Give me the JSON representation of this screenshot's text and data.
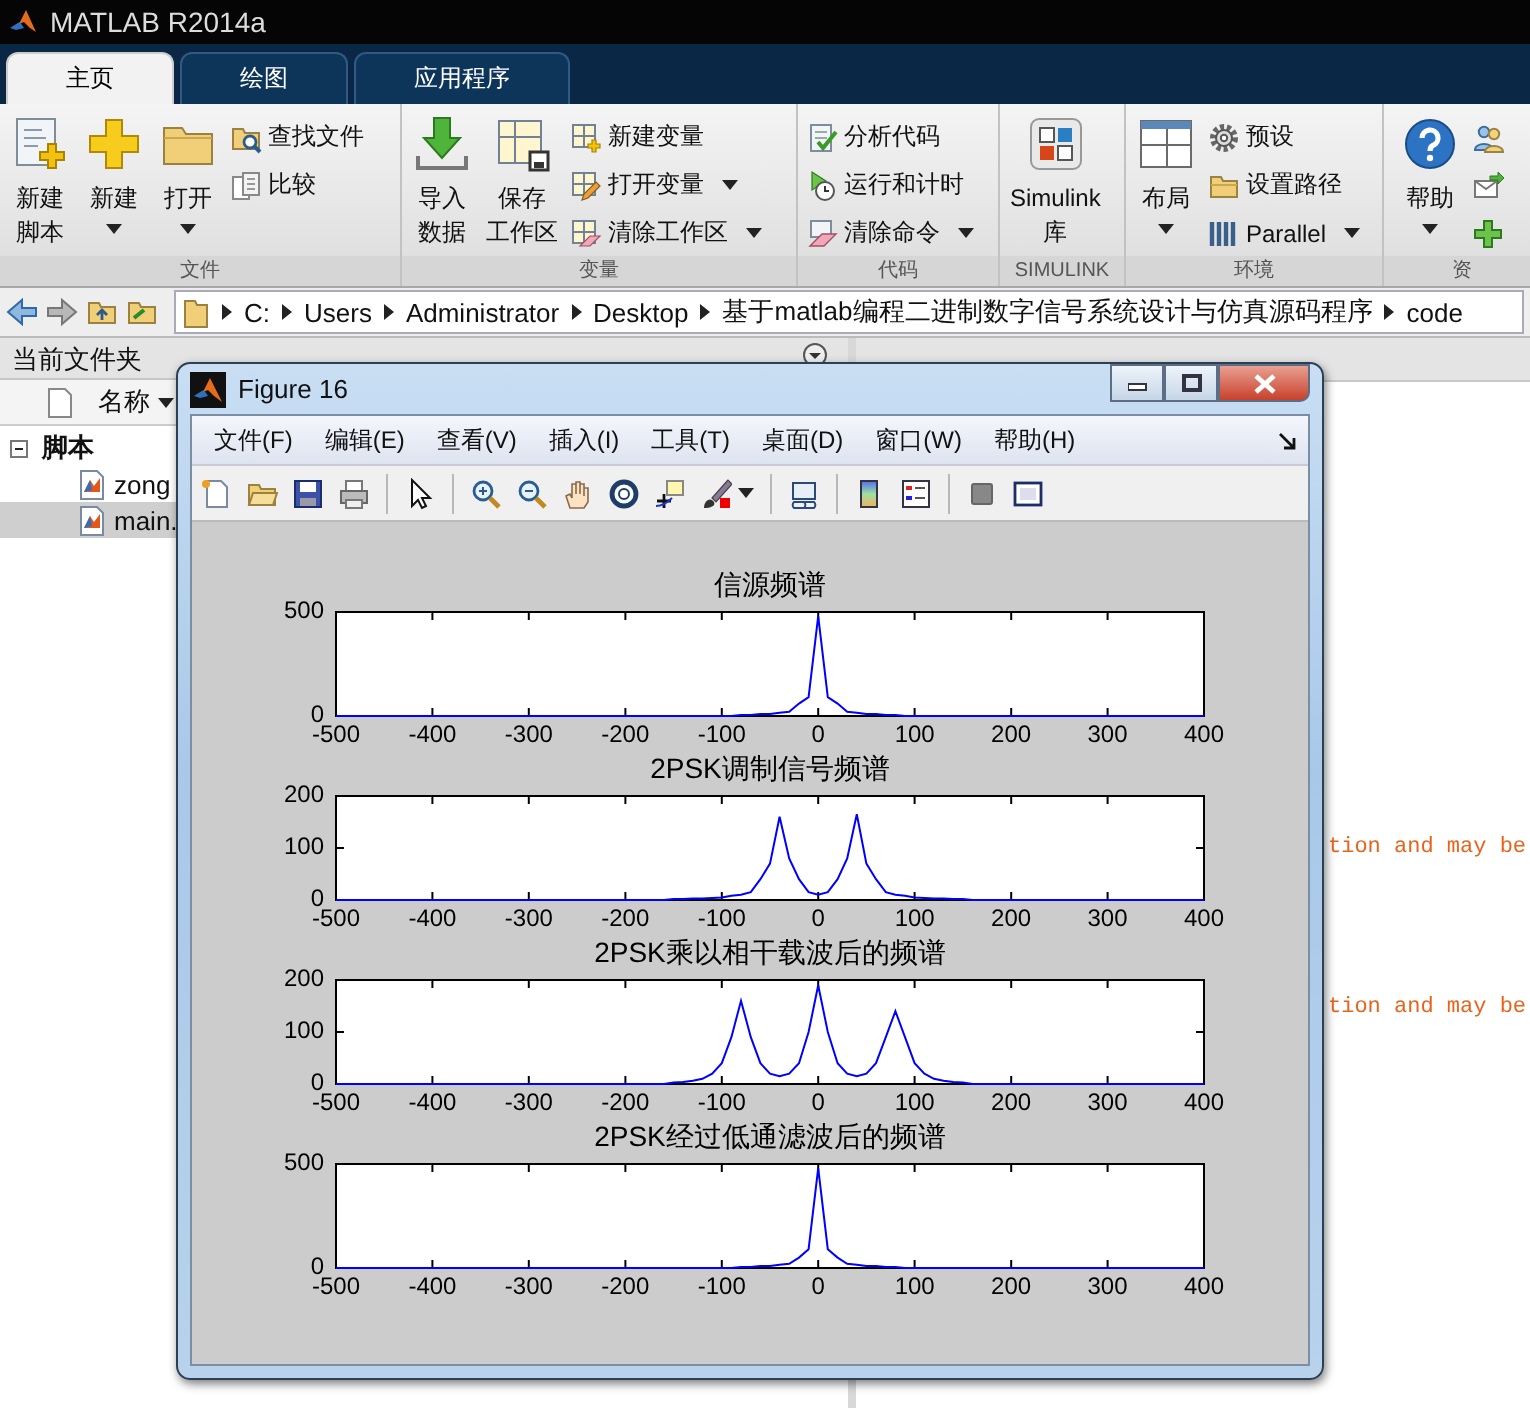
{
  "app": {
    "title": "MATLAB R2014a"
  },
  "tabs": [
    {
      "label": "主页",
      "selected": true
    },
    {
      "label": "绘图",
      "selected": false
    },
    {
      "label": "应用程序",
      "selected": false
    }
  ],
  "toolstrip": {
    "sections": [
      {
        "label": "文件",
        "items": [
          {
            "kind": "large",
            "lines": [
              "新建",
              "脚本"
            ],
            "dropdown": false
          },
          {
            "kind": "large",
            "lines": [
              "新建"
            ],
            "dropdown": true
          },
          {
            "kind": "large",
            "lines": [
              "打开"
            ],
            "dropdown": true
          },
          {
            "kind": "stack",
            "items": [
              {
                "label": "查找文件",
                "dropdown": false
              },
              {
                "label": "比较",
                "dropdown": false
              }
            ]
          }
        ]
      },
      {
        "label": "变量",
        "items": [
          {
            "kind": "large",
            "lines": [
              "导入",
              "数据"
            ],
            "dropdown": false
          },
          {
            "kind": "large",
            "lines": [
              "保存",
              "工作区"
            ],
            "dropdown": false
          },
          {
            "kind": "stack",
            "items": [
              {
                "label": "新建变量",
                "dropdown": false
              },
              {
                "label": "打开变量",
                "dropdown": true
              },
              {
                "label": "清除工作区",
                "dropdown": true
              }
            ]
          }
        ]
      },
      {
        "label": "代码",
        "items": [
          {
            "kind": "stack",
            "items": [
              {
                "label": "分析代码",
                "dropdown": false
              },
              {
                "label": "运行和计时",
                "dropdown": false
              },
              {
                "label": "清除命令",
                "dropdown": true
              }
            ]
          }
        ]
      },
      {
        "label": "SIMULINK",
        "items": [
          {
            "kind": "large",
            "lines": [
              "Simulink",
              "库"
            ],
            "dropdown": false
          }
        ]
      },
      {
        "label": "环境",
        "items": [
          {
            "kind": "large",
            "lines": [
              "布局"
            ],
            "dropdown": true
          },
          {
            "kind": "stack",
            "items": [
              {
                "label": "预设",
                "dropdown": false
              },
              {
                "label": "设置路径",
                "dropdown": false
              },
              {
                "label": "Parallel",
                "dropdown": true
              }
            ]
          }
        ]
      },
      {
        "label": "资",
        "items": [
          {
            "kind": "large",
            "lines": [
              "帮助"
            ],
            "dropdown": true
          },
          {
            "kind": "stack",
            "items": [
              {
                "dropdown": false
              },
              {
                "dropdown": false
              },
              {
                "dropdown": false
              }
            ]
          }
        ]
      }
    ]
  },
  "address_bar": {
    "path": [
      "C:",
      "Users",
      "Administrator",
      "Desktop",
      "基于matlab编程二进制数字信号系统设计与仿真源码程序",
      "code"
    ]
  },
  "current_folder": {
    "title": "当前文件夹",
    "column": "名称",
    "tree": [
      {
        "label": "脚本",
        "expanded": true,
        "children": [
          {
            "label": "zong",
            "selected": false
          },
          {
            "label": "main.",
            "selected": true
          }
        ]
      }
    ]
  },
  "command_window": {
    "lines": [
      "tion and may be",
      "tion and may be"
    ]
  },
  "figure": {
    "title": "Figure 16",
    "menu": [
      "文件(F)",
      "编辑(E)",
      "查看(V)",
      "插入(I)",
      "工具(T)",
      "桌面(D)",
      "窗口(W)",
      "帮助(H)"
    ],
    "plots": [
      {
        "chart_data": {
          "type": "line",
          "title": "信源频谱",
          "xlim": [
            -500,
            400
          ],
          "ylim": [
            0,
            500
          ],
          "xticks": [
            -500,
            -400,
            -300,
            -200,
            -100,
            0,
            100,
            200,
            300,
            400
          ],
          "yticks": [
            0,
            500
          ],
          "x": [
            -500,
            -490,
            -480,
            -470,
            -460,
            -450,
            -440,
            -430,
            -420,
            -410,
            -400,
            -390,
            -380,
            -370,
            -360,
            -350,
            -340,
            -330,
            -320,
            -310,
            -300,
            -290,
            -280,
            -270,
            -260,
            -250,
            -240,
            -230,
            -220,
            -210,
            -200,
            -190,
            -180,
            -170,
            -160,
            -150,
            -140,
            -130,
            -120,
            -110,
            -100,
            -90,
            -80,
            -70,
            -60,
            -50,
            -40,
            -30,
            -20,
            -10,
            0,
            10,
            20,
            30,
            40,
            50,
            60,
            70,
            80,
            90,
            100,
            110,
            120,
            130,
            140,
            150,
            160,
            170,
            180,
            190,
            200,
            210,
            220,
            230,
            240,
            250,
            260,
            270,
            280,
            290,
            300,
            310,
            320,
            330,
            340,
            350,
            360,
            370,
            380,
            390,
            400
          ],
          "series": [
            {
              "color": "#0000ff",
              "values": [
                0,
                0,
                0,
                0,
                0,
                0,
                0,
                0,
                0,
                0,
                0,
                0,
                0,
                0,
                0,
                0,
                0,
                0,
                0,
                0,
                0,
                0,
                0,
                0,
                0,
                0,
                0,
                0,
                0,
                0,
                0,
                0,
                0,
                0,
                0,
                0,
                0,
                0,
                0,
                0,
                0,
                0,
                5,
                5,
                10,
                10,
                15,
                20,
                60,
                90,
                480,
                90,
                60,
                20,
                15,
                10,
                10,
                5,
                5,
                0,
                0,
                0,
                0,
                0,
                0,
                0,
                0,
                0,
                0,
                0,
                0,
                0,
                0,
                0,
                0,
                0,
                0,
                0,
                0,
                0,
                0,
                0,
                0,
                0,
                0,
                0,
                0,
                0,
                0,
                0,
                0
              ]
            }
          ]
        }
      },
      {
        "chart_data": {
          "type": "line",
          "title": "2PSK调制信号频谱",
          "xlim": [
            -500,
            400
          ],
          "ylim": [
            0,
            200
          ],
          "xticks": [
            -500,
            -400,
            -300,
            -200,
            -100,
            0,
            100,
            200,
            300,
            400
          ],
          "yticks": [
            0,
            100,
            200
          ],
          "x": [
            -500,
            -490,
            -480,
            -470,
            -460,
            -450,
            -440,
            -430,
            -420,
            -410,
            -400,
            -390,
            -380,
            -370,
            -360,
            -350,
            -340,
            -330,
            -320,
            -310,
            -300,
            -290,
            -280,
            -270,
            -260,
            -250,
            -240,
            -230,
            -220,
            -210,
            -200,
            -190,
            -180,
            -170,
            -160,
            -150,
            -140,
            -130,
            -120,
            -110,
            -100,
            -90,
            -80,
            -70,
            -60,
            -50,
            -40,
            -30,
            -20,
            -10,
            0,
            10,
            20,
            30,
            40,
            50,
            60,
            70,
            80,
            90,
            100,
            110,
            120,
            130,
            140,
            150,
            160,
            170,
            180,
            190,
            200,
            210,
            220,
            230,
            240,
            250,
            260,
            270,
            280,
            290,
            300,
            310,
            320,
            330,
            340,
            350,
            360,
            370,
            380,
            390,
            400
          ],
          "series": [
            {
              "color": "#0000ff",
              "values": [
                0,
                0,
                0,
                0,
                0,
                0,
                0,
                0,
                0,
                0,
                0,
                0,
                0,
                0,
                0,
                0,
                0,
                0,
                0,
                0,
                0,
                0,
                0,
                0,
                0,
                0,
                0,
                0,
                0,
                0,
                0,
                0,
                0,
                0,
                0,
                2,
                2,
                3,
                3,
                4,
                5,
                8,
                10,
                15,
                40,
                70,
                160,
                80,
                40,
                15,
                10,
                15,
                40,
                80,
                165,
                70,
                40,
                15,
                10,
                8,
                5,
                4,
                3,
                3,
                2,
                2,
                0,
                0,
                0,
                0,
                0,
                0,
                0,
                0,
                0,
                0,
                0,
                0,
                0,
                0,
                0,
                0,
                0,
                0,
                0,
                0,
                0,
                0,
                0,
                0,
                0
              ]
            }
          ]
        }
      },
      {
        "chart_data": {
          "type": "line",
          "title": "2PSK乘以相干载波后的频谱",
          "xlim": [
            -500,
            400
          ],
          "ylim": [
            0,
            200
          ],
          "xticks": [
            -500,
            -400,
            -300,
            -200,
            -100,
            0,
            100,
            200,
            300,
            400
          ],
          "yticks": [
            0,
            100,
            200
          ],
          "x": [
            -500,
            -490,
            -480,
            -470,
            -460,
            -450,
            -440,
            -430,
            -420,
            -410,
            -400,
            -390,
            -380,
            -370,
            -360,
            -350,
            -340,
            -330,
            -320,
            -310,
            -300,
            -290,
            -280,
            -270,
            -260,
            -250,
            -240,
            -230,
            -220,
            -210,
            -200,
            -190,
            -180,
            -170,
            -160,
            -150,
            -140,
            -130,
            -120,
            -110,
            -100,
            -90,
            -80,
            -70,
            -60,
            -50,
            -40,
            -30,
            -20,
            -10,
            0,
            10,
            20,
            30,
            40,
            50,
            60,
            70,
            80,
            90,
            100,
            110,
            120,
            130,
            140,
            150,
            160,
            170,
            180,
            190,
            200,
            210,
            220,
            230,
            240,
            250,
            260,
            270,
            280,
            290,
            300,
            310,
            320,
            330,
            340,
            350,
            360,
            370,
            380,
            390,
            400
          ],
          "series": [
            {
              "color": "#0000ff",
              "values": [
                0,
                0,
                0,
                0,
                0,
                0,
                0,
                0,
                0,
                0,
                0,
                0,
                0,
                0,
                0,
                0,
                0,
                0,
                0,
                0,
                0,
                0,
                0,
                0,
                0,
                0,
                0,
                0,
                0,
                0,
                0,
                0,
                0,
                0,
                0,
                3,
                4,
                6,
                10,
                20,
                40,
                90,
                160,
                90,
                40,
                20,
                15,
                20,
                40,
                100,
                190,
                100,
                40,
                20,
                15,
                20,
                40,
                90,
                140,
                90,
                40,
                20,
                10,
                6,
                4,
                3,
                0,
                0,
                0,
                0,
                0,
                0,
                0,
                0,
                0,
                0,
                0,
                0,
                0,
                0,
                0,
                0,
                0,
                0,
                0,
                0,
                0,
                0,
                0,
                0,
                0
              ]
            }
          ]
        }
      },
      {
        "chart_data": {
          "type": "line",
          "title": "2PSK经过低通滤波后的频谱",
          "xlim": [
            -500,
            400
          ],
          "ylim": [
            0,
            500
          ],
          "xticks": [
            -500,
            -400,
            -300,
            -200,
            -100,
            0,
            100,
            200,
            300,
            400
          ],
          "yticks": [
            0,
            500
          ],
          "x": [
            -500,
            -490,
            -480,
            -470,
            -460,
            -450,
            -440,
            -430,
            -420,
            -410,
            -400,
            -390,
            -380,
            -370,
            -360,
            -350,
            -340,
            -330,
            -320,
            -310,
            -300,
            -290,
            -280,
            -270,
            -260,
            -250,
            -240,
            -230,
            -220,
            -210,
            -200,
            -190,
            -180,
            -170,
            -160,
            -150,
            -140,
            -130,
            -120,
            -110,
            -100,
            -90,
            -80,
            -70,
            -60,
            -50,
            -40,
            -30,
            -20,
            -10,
            0,
            10,
            20,
            30,
            40,
            50,
            60,
            70,
            80,
            90,
            100,
            110,
            120,
            130,
            140,
            150,
            160,
            170,
            180,
            190,
            200,
            210,
            220,
            230,
            240,
            250,
            260,
            270,
            280,
            290,
            300,
            310,
            320,
            330,
            340,
            350,
            360,
            370,
            380,
            390,
            400
          ],
          "series": [
            {
              "color": "#0000ff",
              "values": [
                0,
                0,
                0,
                0,
                0,
                0,
                0,
                0,
                0,
                0,
                0,
                0,
                0,
                0,
                0,
                0,
                0,
                0,
                0,
                0,
                0,
                0,
                0,
                0,
                0,
                0,
                0,
                0,
                0,
                0,
                0,
                0,
                0,
                0,
                0,
                0,
                0,
                0,
                0,
                0,
                0,
                0,
                5,
                5,
                10,
                10,
                15,
                20,
                50,
                90,
                480,
                90,
                50,
                20,
                15,
                10,
                10,
                5,
                5,
                0,
                0,
                0,
                0,
                0,
                0,
                0,
                0,
                0,
                0,
                0,
                0,
                0,
                0,
                0,
                0,
                0,
                0,
                0,
                0,
                0,
                0,
                0,
                0,
                0,
                0,
                0,
                0,
                0,
                0,
                0,
                0
              ]
            }
          ]
        }
      }
    ]
  }
}
